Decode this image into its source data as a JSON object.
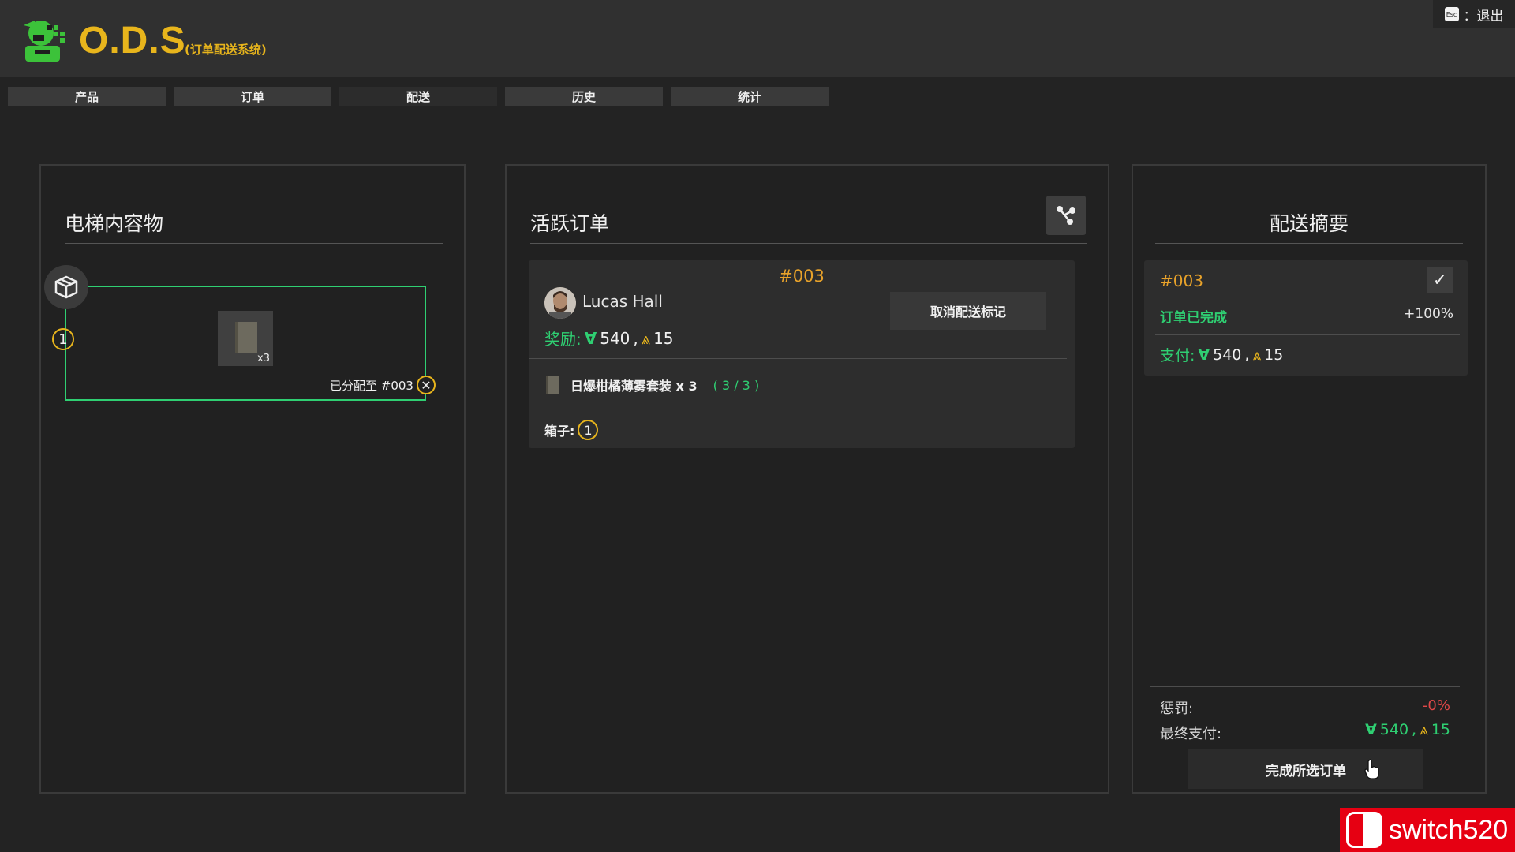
{
  "app": {
    "brand": "O.D.S",
    "subtitle": "(订单配送系统)",
    "exit_label": "：退出",
    "esc_key": "Esc"
  },
  "tabs": [
    "产品",
    "订单",
    "配送",
    "历史",
    "统计"
  ],
  "active_tab": "配送",
  "elevator": {
    "title": "电梯内容物",
    "box_number": "1",
    "item_qty": "x3",
    "assigned_label": "已分配至 #003"
  },
  "orders": {
    "title": "活跃订单",
    "order": {
      "id": "#003",
      "customer": "Lucas Hall",
      "reward_label": "奖励:",
      "money": "540",
      "separator": ",",
      "rank": "15",
      "cancel_label": "取消配送标记",
      "item_name": "日爆柑橘薄雾套装 x 3",
      "item_progress": "( 3 / 3 )",
      "boxes_label": "箱子:",
      "box_number": "1"
    }
  },
  "summary": {
    "title": "配送摘要",
    "order_id": "#003",
    "status": "订单已完成",
    "percent": "+100%",
    "pay_label": "支付:",
    "money": "540",
    "separator": ",",
    "rank": "15",
    "penalty_label": "惩罚:",
    "penalty_value": "-0%",
    "final_label": "最终支付:",
    "final_money": "540",
    "final_rank": "15",
    "complete_label": "完成所选订单"
  },
  "watermark": "switch520",
  "colors": {
    "accent_gold": "#e8b51c",
    "order_id": "#e8a22a",
    "success_green": "#2fcf72",
    "penalty_red": "#e04848",
    "background": "#232323"
  }
}
